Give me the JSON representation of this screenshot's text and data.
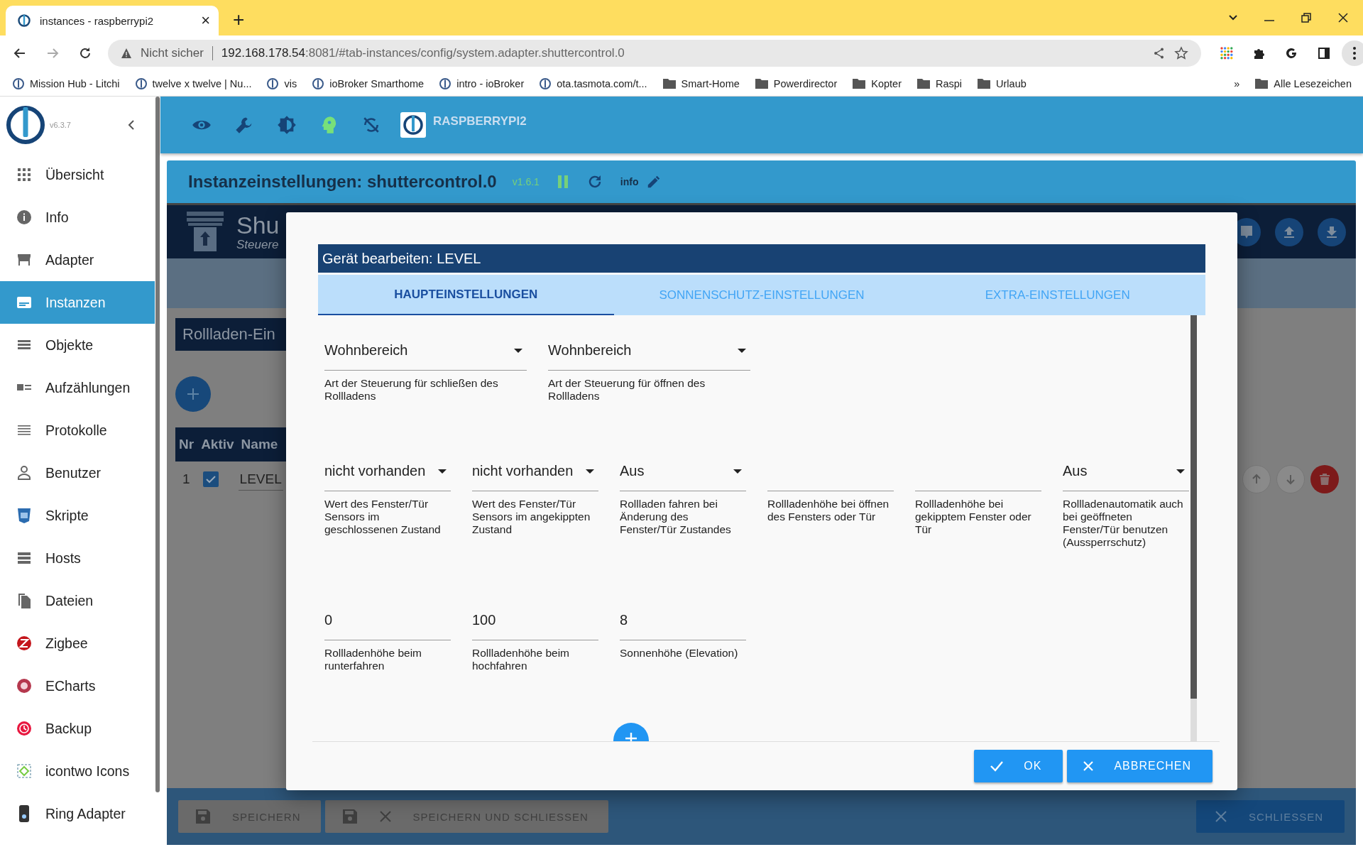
{
  "browser": {
    "tab": {
      "title": "instances - raspberrypi2",
      "close": "×"
    },
    "new_tab": "+",
    "security": "Nicht sicher",
    "url_host": "192.168.178.54",
    "url_rest": ":8081/#tab-instances/config/system.adapter.shuttercontrol.0",
    "bookmarks": [
      {
        "label": "Mission Hub - Litchi",
        "kind": "site"
      },
      {
        "label": "twelve x twelve | Nu...",
        "kind": "site"
      },
      {
        "label": "vis",
        "kind": "site"
      },
      {
        "label": "ioBroker Smarthome",
        "kind": "site"
      },
      {
        "label": "intro - ioBroker",
        "kind": "site"
      },
      {
        "label": "ota.tasmota.com/t...",
        "kind": "site"
      },
      {
        "label": "Smart-Home",
        "kind": "folder"
      },
      {
        "label": "Powerdirector",
        "kind": "folder"
      },
      {
        "label": "Kopter",
        "kind": "folder"
      },
      {
        "label": "Raspi",
        "kind": "folder"
      },
      {
        "label": "Urlaub",
        "kind": "folder"
      }
    ],
    "more": "»",
    "all_bookmarks": "Alle Lesezeichen"
  },
  "sidebar": {
    "version": "v6.3.7",
    "items": [
      {
        "label": "Übersicht",
        "selected": false
      },
      {
        "label": "Info",
        "selected": false
      },
      {
        "label": "Adapter",
        "selected": false
      },
      {
        "label": "Instanzen",
        "selected": true
      },
      {
        "label": "Objekte",
        "selected": false
      },
      {
        "label": "Aufzählungen",
        "selected": false
      },
      {
        "label": "Protokolle",
        "selected": false
      },
      {
        "label": "Benutzer",
        "selected": false
      },
      {
        "label": "Skripte",
        "selected": false
      },
      {
        "label": "Hosts",
        "selected": false
      },
      {
        "label": "Dateien",
        "selected": false
      },
      {
        "label": "Zigbee",
        "selected": false
      },
      {
        "label": "ECharts",
        "selected": false
      },
      {
        "label": "Backup",
        "selected": false
      },
      {
        "label": "icontwo Icons",
        "selected": false
      },
      {
        "label": "Ring Adapter",
        "selected": false
      }
    ]
  },
  "toolbar": {
    "host": "RASPBERRYPI2"
  },
  "instance_header": {
    "title": "Instanzeinstellungen: shuttercontrol.0",
    "version": "v1.6.1",
    "info": "info"
  },
  "adapter_panel": {
    "title": "Shu",
    "subtitle": "Steuere",
    "section": "Rollladen-Ein",
    "columns": [
      "Nr",
      "Aktiv",
      "Name"
    ],
    "rows": [
      {
        "nr": "1",
        "active": true,
        "name": "LEVEL"
      }
    ],
    "buttons": [
      "SPEICHERN",
      "SPEICHERN UND SCHLIESSEN"
    ],
    "close": "SCHLIESSEN"
  },
  "dialog": {
    "title": "Gerät bearbeiten: LEVEL",
    "tabs": [
      {
        "label": "HAUPTEINSTELLUNGEN",
        "selected": true
      },
      {
        "label": "SONNENSCHUTZ-EINSTELLUNGEN",
        "selected": false
      },
      {
        "label": "EXTRA-EINSTELLUNGEN",
        "selected": false
      }
    ],
    "rows": [
      [
        {
          "kind": "select",
          "value": "Wohnbereich",
          "helper": "Art der Steuerung für schließen des Rollladens"
        },
        {
          "kind": "select",
          "value": "Wohnbereich",
          "helper": "Art der Steuerung für öffnen des Rollladens"
        }
      ],
      [
        {
          "kind": "select",
          "value": "nicht vorhanden",
          "helper": "Wert des Fenster/Tür Sensors im geschlossenen Zustand"
        },
        {
          "kind": "select",
          "value": "nicht vorhanden",
          "helper": "Wert des Fenster/Tür Sensors im angekippten Zustand"
        },
        {
          "kind": "select",
          "value": "Aus",
          "helper": "Rollladen fahren bei Änderung des Fenster/Tür Zustandes"
        },
        {
          "kind": "text",
          "helper": "Rollladenhöhe bei öffnen des Fensters oder Tür"
        },
        {
          "kind": "text",
          "helper": "Rollladenhöhe bei gekipptem Fenster oder Tür"
        },
        {
          "kind": "select",
          "value": "Aus",
          "helper": "Rollladenautomatik auch bei geöffneten Fenster/Tür benutzen (Aussperrschutz)"
        }
      ],
      [
        {
          "kind": "text",
          "value": "0",
          "helper": "Rollladenhöhe beim runterfahren"
        },
        {
          "kind": "text",
          "value": "100",
          "helper": "Rollladenhöhe beim hochfahren"
        },
        {
          "kind": "text",
          "value": "8",
          "helper": "Sonnenhöhe (Elevation)"
        }
      ]
    ],
    "buttons": [
      {
        "kind": "ok",
        "label": "OK"
      },
      {
        "kind": "cancel",
        "label": "ABBRECHEN"
      }
    ]
  }
}
